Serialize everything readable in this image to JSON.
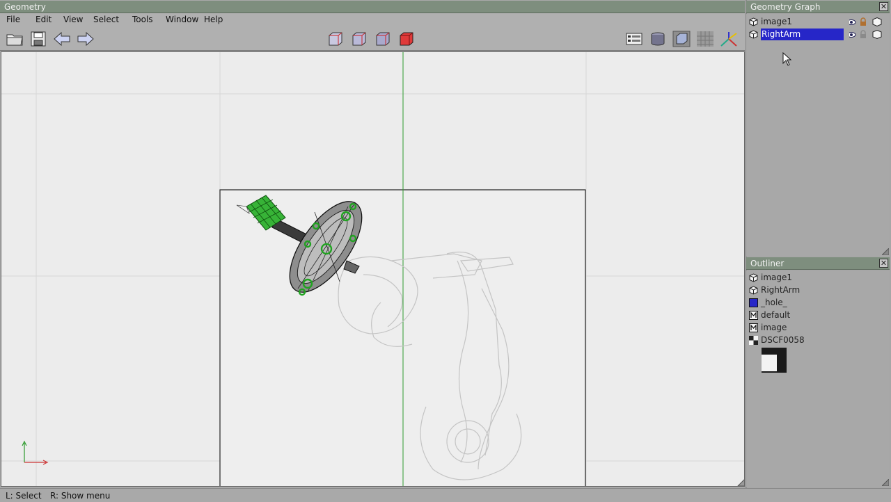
{
  "geometry_window": {
    "title": "Geometry",
    "menu": [
      "File",
      "Edit",
      "View",
      "Select",
      "Tools",
      "Window",
      "Help"
    ]
  },
  "geometry_graph": {
    "title": "Geometry Graph",
    "items": [
      {
        "label": "image1",
        "selected": false
      },
      {
        "label": "RightArm",
        "selected": true
      }
    ]
  },
  "outliner": {
    "title": "Outliner",
    "items": [
      {
        "label": "image1",
        "icon": "cube-icon"
      },
      {
        "label": "RightArm",
        "icon": "cube-icon"
      },
      {
        "label": "_hole_",
        "icon": "blue-swatch-icon"
      },
      {
        "label": "default",
        "icon": "material-icon"
      },
      {
        "label": "image",
        "icon": "material-icon"
      },
      {
        "label": "DSCF0058",
        "icon": "texture-icon"
      }
    ]
  },
  "statusbar": {
    "left_hint": "L: Select",
    "right_hint": "R: Show menu"
  },
  "colors": {
    "titlebar": "#7e8e7e",
    "selection": "#2626c8",
    "wire_green": "#2d9a2d",
    "camera_frame": "#222222"
  }
}
